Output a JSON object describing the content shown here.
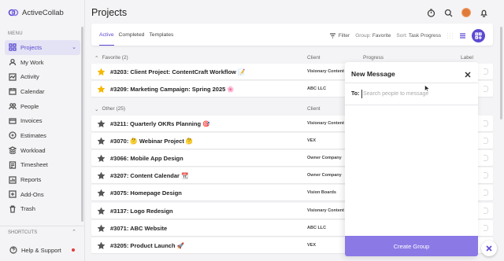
{
  "app": {
    "name": "ActiveCollab"
  },
  "sidebar": {
    "menu_label": "MENU",
    "items": [
      {
        "label": "Projects",
        "icon": "grid-icon"
      },
      {
        "label": "My Work",
        "icon": "person-icon"
      },
      {
        "label": "Activity",
        "icon": "activity-icon"
      },
      {
        "label": "Calendar",
        "icon": "calendar-icon"
      },
      {
        "label": "People",
        "icon": "people-icon"
      },
      {
        "label": "Invoices",
        "icon": "invoice-icon"
      },
      {
        "label": "Estimates",
        "icon": "estimate-icon"
      },
      {
        "label": "Workload",
        "icon": "workload-icon"
      },
      {
        "label": "Timesheet",
        "icon": "timesheet-icon"
      },
      {
        "label": "Reports",
        "icon": "reports-icon"
      },
      {
        "label": "Add-Ons",
        "icon": "addons-icon"
      },
      {
        "label": "Trash",
        "icon": "trash-icon"
      }
    ],
    "shortcuts_label": "SHORTCUTS",
    "help_label": "Help & Support"
  },
  "header": {
    "title": "Projects"
  },
  "toolbar": {
    "tabs": [
      "Active",
      "Completed",
      "Templates"
    ],
    "filter_label": "Filter",
    "group_label": "Group:",
    "group_value": "Favorite",
    "sort_label": "Sort:",
    "sort_value": "Task Progress"
  },
  "columns": {
    "client": "Client",
    "progress": "Progress",
    "label": "Label"
  },
  "groups": {
    "favorite": {
      "label": "Favorite (2)"
    },
    "other": {
      "label": "Other (25)"
    }
  },
  "rows": [
    {
      "name": "#3203: Client Project: ContentCraft Workflow 📝",
      "client": "Visionary Content Co.",
      "favorite": true
    },
    {
      "name": "#3209: Marketing Campaign: Spring 2025 🌸",
      "client": "ABC LLC",
      "favorite": true
    },
    {
      "name": "#3211: Quarterly OKRs Planning 🎯",
      "client": "Visionary Content Co.",
      "favorite": false
    },
    {
      "name": "#3070: 🤔 Webinar Project 🤔",
      "client": "VEX",
      "favorite": false
    },
    {
      "name": "#3066: Mobile App Design",
      "client": "Owner Company",
      "favorite": false
    },
    {
      "name": "#3207: Content Calendar 📆",
      "client": "Owner Company",
      "favorite": false
    },
    {
      "name": "#3075: Homepage Design",
      "client": "Vision Boards",
      "favorite": false
    },
    {
      "name": "#3137: Logo Redesign",
      "client": "Visionary Content Co.",
      "favorite": false
    },
    {
      "name": "#3071: ABC Website",
      "client": "ABC LLC",
      "favorite": false
    },
    {
      "name": "#3205: Product Launch 🚀",
      "client": "VEX",
      "favorite": false
    }
  ],
  "dialog": {
    "title": "New Message",
    "to_label": "To:",
    "to_placeholder": "Search people to message",
    "to_value": "",
    "create_label": "Create Group"
  },
  "colors": {
    "accent": "#5b4ad1",
    "create_button": "#8b79e6",
    "star_favorite": "#f5b800",
    "star_default": "#555555"
  }
}
